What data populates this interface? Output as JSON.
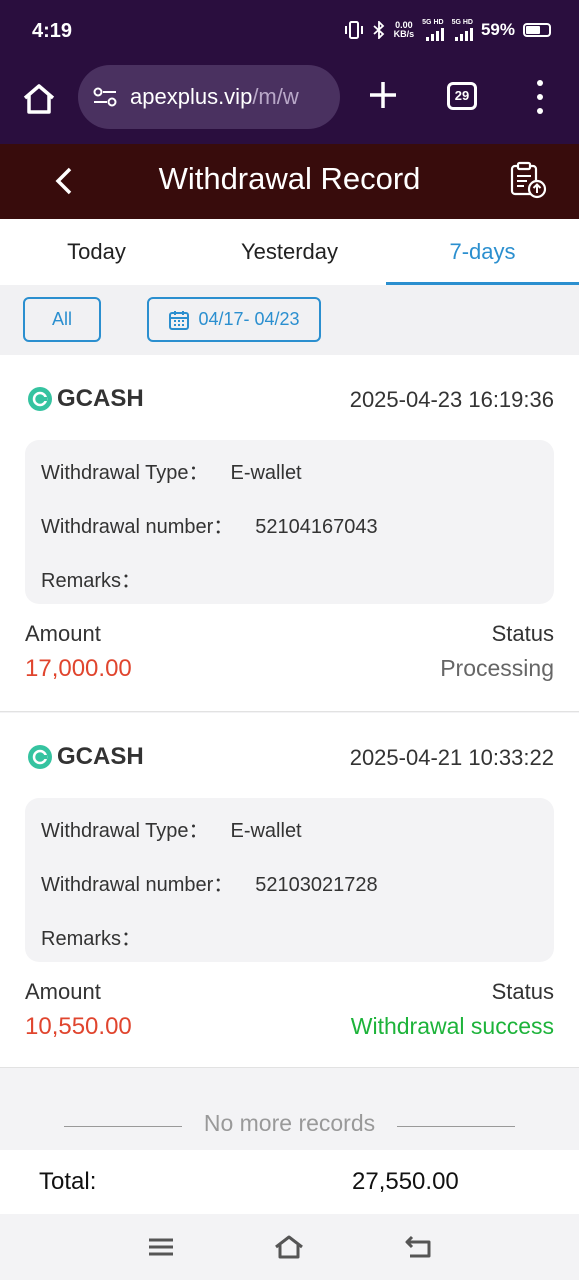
{
  "status_bar": {
    "time": "4:19",
    "net_speed_value": "0.00",
    "net_speed_unit": "KB/s",
    "sim1": "5G HD",
    "sim2": "5G HD",
    "battery": "59%"
  },
  "browser": {
    "url_host": "apexplus.vip",
    "url_path": "/m/w",
    "tab_count": "29"
  },
  "header": {
    "title": "Withdrawal Record"
  },
  "tabs": [
    {
      "label": "Today",
      "active": false
    },
    {
      "label": "Yesterday",
      "active": false
    },
    {
      "label": "7-days",
      "active": true
    }
  ],
  "filters": {
    "all_label": "All",
    "date_range": "04/17- 04/23"
  },
  "records": [
    {
      "brand": "GCASH",
      "datetime": "2025-04-23 16:19:36",
      "type_label": "Withdrawal Type：",
      "type_value": "E-wallet",
      "number_label": "Withdrawal number：",
      "number_value": "52104167043",
      "remarks_label": "Remarks：",
      "remarks_value": "",
      "amount_label": "Amount",
      "amount_value": "17,000.00",
      "status_label": "Status",
      "status_value": "Processing",
      "status_color": "#666666"
    },
    {
      "brand": "GCASH",
      "datetime": "2025-04-21 10:33:22",
      "type_label": "Withdrawal Type：",
      "type_value": "E-wallet",
      "number_label": "Withdrawal number：",
      "number_value": "52103021728",
      "remarks_label": "Remarks：",
      "remarks_value": "",
      "amount_label": "Amount",
      "amount_value": "10,550.00",
      "status_label": "Status",
      "status_value": "Withdrawal success",
      "status_color": "#1db33a"
    }
  ],
  "footer": {
    "no_more": "No more records",
    "total_label": "Total:",
    "total_value": "27,550.00"
  },
  "colors": {
    "accent": "#2b8fcf",
    "amount": "#e0452e",
    "header_bg": "#380c0c",
    "browser_bg": "#2a0e3e"
  },
  "icons": [
    "home-icon",
    "tune-icon",
    "plus-icon",
    "tabs-icon",
    "more-vert-icon",
    "back-icon",
    "record-upload-icon",
    "calendar-icon",
    "gcash-logo",
    "nav-menu-icon",
    "nav-home-icon",
    "nav-back-icon"
  ]
}
